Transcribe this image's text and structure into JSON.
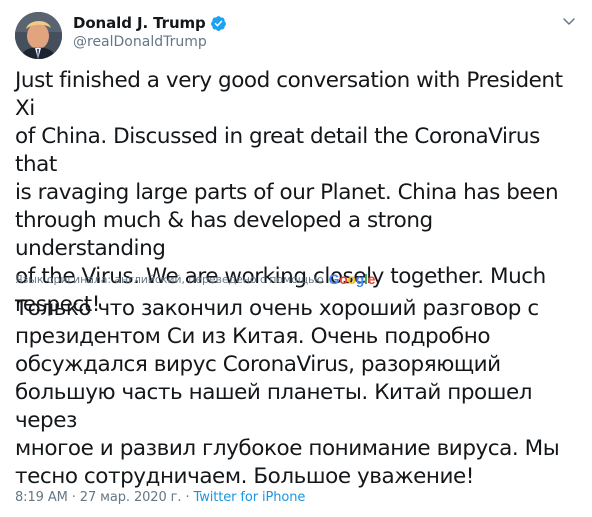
{
  "author": {
    "display_name": "Donald J. Trump",
    "handle": "@realDonaldTrump",
    "verified": true
  },
  "tweet": {
    "text": "Just finished a very good conversation with President Xi\nof China. Discussed in great detail the CoronaVirus that\nis ravaging large parts of our Planet. China has been\nthrough much & has developed a strong understanding\nof the Virus. We are working closely together. Much\nrespect!"
  },
  "translation": {
    "notice": "Язык оригинала: английский, переведено с помощью",
    "provider": "Google",
    "text": "Только что закончил очень хороший разговор с\nпрезидентом Си из Китая. Очень подробно\nобсуждался вирус CoronaVirus, разоряющий\nбольшую часть нашей планеты. Китай прошел через\nмногое и развил глубокое понимание вируса. Мы\nтесно сотрудничаем. Большое уважение!"
  },
  "meta": {
    "time": "8:19 AM",
    "separator": "·",
    "date": "27 мар. 2020 г.",
    "source": "Twitter for iPhone"
  },
  "colors": {
    "text": "#14171a",
    "secondary": "#657786",
    "link": "#1b95e0",
    "verified": "#1da1f2"
  },
  "icons": {
    "verified": "verified-badge-icon",
    "menu": "chevron-down-icon"
  }
}
